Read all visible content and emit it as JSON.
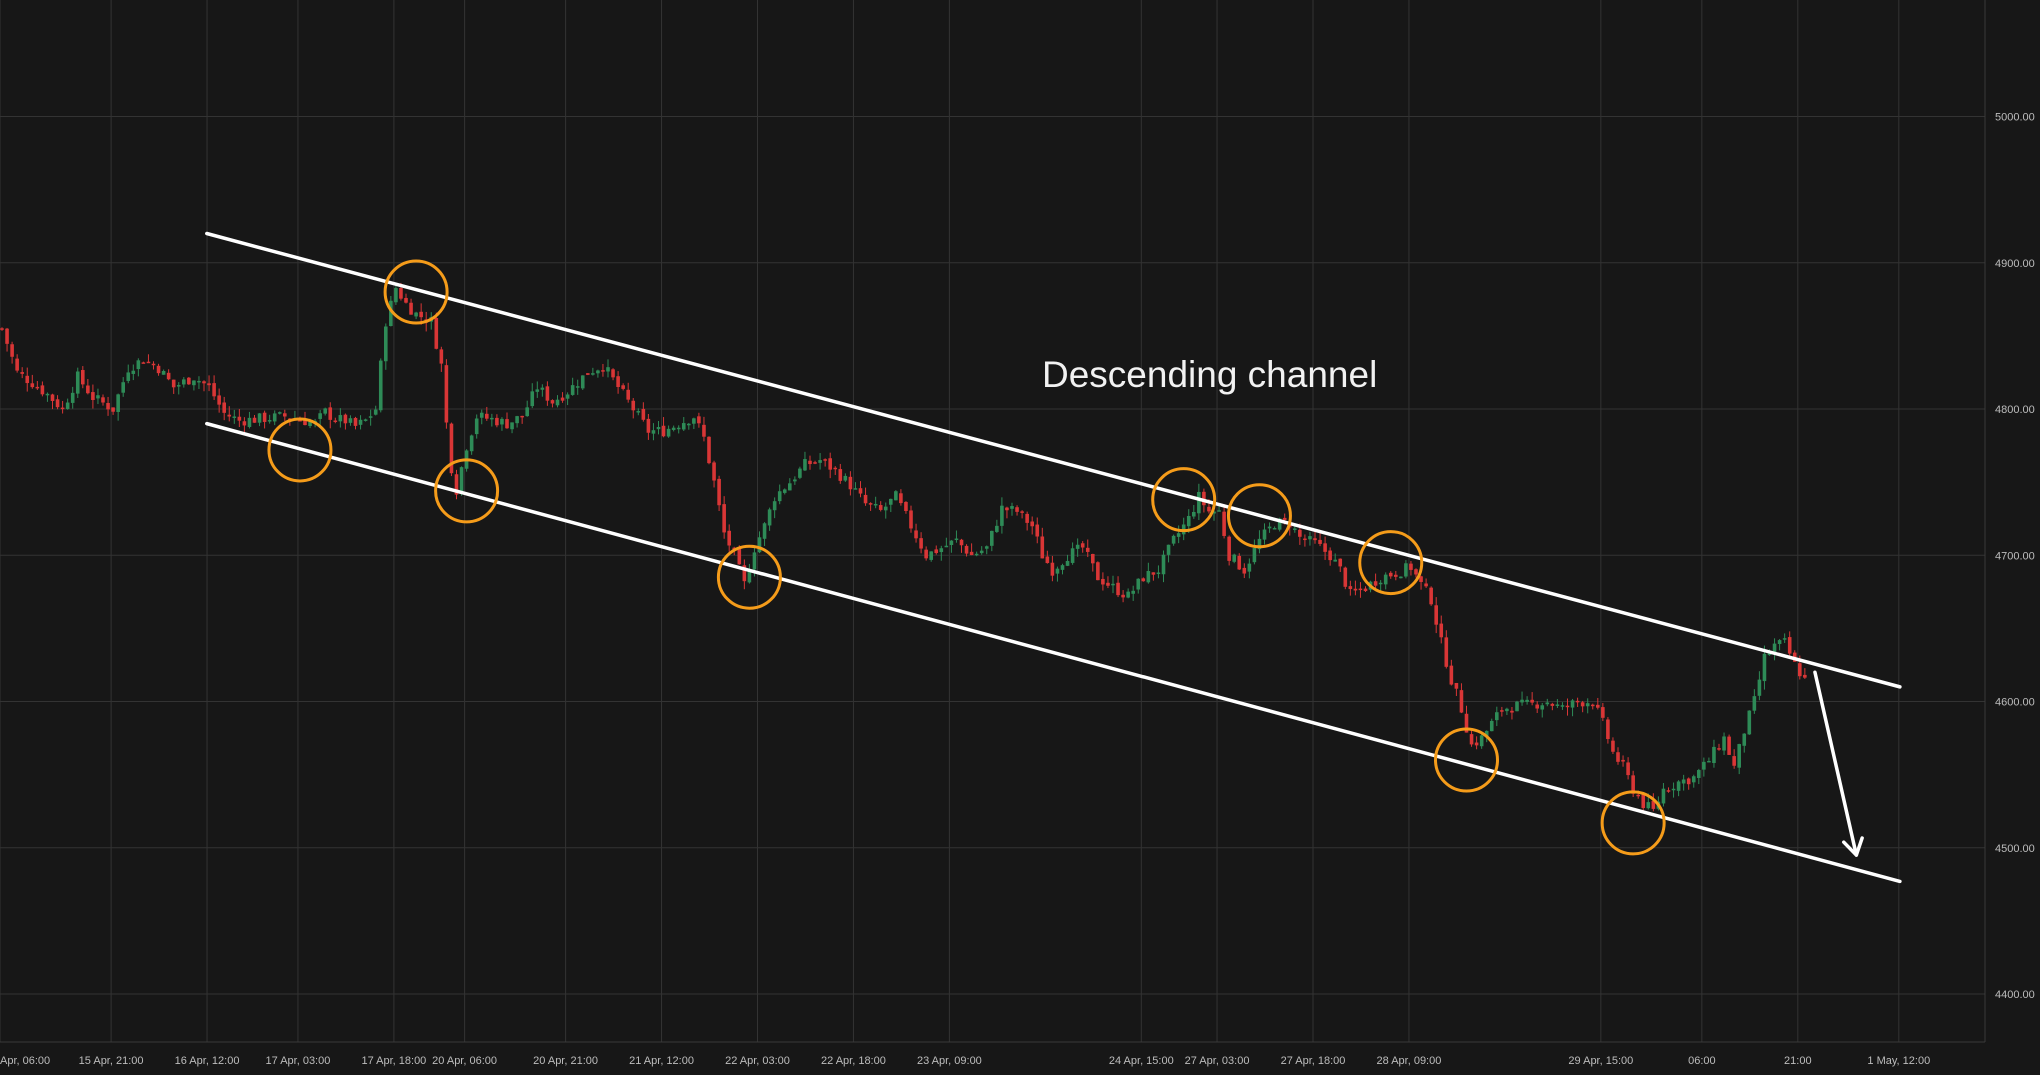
{
  "chart_data": {
    "type": "candlestick",
    "annotation": "Descending channel",
    "y_ticks": [
      4400,
      4500,
      4600,
      4700,
      4800,
      4900,
      5000
    ],
    "y_tick_labels": [
      "4400.00",
      "4500.00",
      "4600.00",
      "4700.00",
      "4800.00",
      "4900.00",
      "5000.00"
    ],
    "ylim": [
      4365,
      5035
    ],
    "x_tick_labels": [
      "Apr, 06:00",
      "15 Apr, 21:00",
      "16 Apr, 12:00",
      "17 Apr, 03:00",
      "17 Apr, 18:00",
      "20 Apr, 06:00",
      "20 Apr, 21:00",
      "21 Apr, 12:00",
      "22 Apr, 03:00",
      "22 Apr, 18:00",
      "23 Apr, 09:00",
      "24 Apr, 15:00",
      "27 Apr, 03:00",
      "27 Apr, 18:00",
      "28 Apr, 09:00",
      "29 Apr, 15:00",
      "06:00",
      "21:00",
      "1 May, 12:00"
    ],
    "x_tick_index": [
      0,
      22,
      41,
      59,
      78,
      92,
      112,
      131,
      150,
      169,
      188,
      226,
      241,
      260,
      279,
      317,
      337,
      356,
      376
    ],
    "price_path": [
      [
        0,
        4855
      ],
      [
        3,
        4825
      ],
      [
        6,
        4818
      ],
      [
        9,
        4810
      ],
      [
        12,
        4800
      ],
      [
        15,
        4822
      ],
      [
        18,
        4808
      ],
      [
        22,
        4800
      ],
      [
        25,
        4828
      ],
      [
        28,
        4834
      ],
      [
        31,
        4828
      ],
      [
        34,
        4815
      ],
      [
        38,
        4822
      ],
      [
        41,
        4815
      ],
      [
        44,
        4797
      ],
      [
        47,
        4792
      ],
      [
        50,
        4793
      ],
      [
        53,
        4794
      ],
      [
        56,
        4795
      ],
      [
        59,
        4793
      ],
      [
        62,
        4790
      ],
      [
        64,
        4798
      ],
      [
        66,
        4793
      ],
      [
        68,
        4792
      ],
      [
        70,
        4788
      ],
      [
        72,
        4792
      ],
      [
        74,
        4800
      ],
      [
        76,
        4860
      ],
      [
        78,
        4883
      ],
      [
        80,
        4872
      ],
      [
        82,
        4865
      ],
      [
        85,
        4860
      ],
      [
        87,
        4830
      ],
      [
        88,
        4790
      ],
      [
        89,
        4760
      ],
      [
        90,
        4745
      ],
      [
        92,
        4775
      ],
      [
        94,
        4795
      ],
      [
        97,
        4793
      ],
      [
        100,
        4790
      ],
      [
        103,
        4795
      ],
      [
        106,
        4815
      ],
      [
        109,
        4805
      ],
      [
        112,
        4812
      ],
      [
        116,
        4825
      ],
      [
        119,
        4830
      ],
      [
        122,
        4815
      ],
      [
        125,
        4800
      ],
      [
        128,
        4785
      ],
      [
        131,
        4785
      ],
      [
        134,
        4790
      ],
      [
        137,
        4795
      ],
      [
        139,
        4780
      ],
      [
        141,
        4750
      ],
      [
        143,
        4715
      ],
      [
        145,
        4700
      ],
      [
        147,
        4680
      ],
      [
        149,
        4705
      ],
      [
        151,
        4720
      ],
      [
        153,
        4740
      ],
      [
        156,
        4750
      ],
      [
        159,
        4762
      ],
      [
        162,
        4765
      ],
      [
        165,
        4758
      ],
      [
        168,
        4748
      ],
      [
        171,
        4735
      ],
      [
        174,
        4730
      ],
      [
        177,
        4740
      ],
      [
        180,
        4720
      ],
      [
        183,
        4700
      ],
      [
        186,
        4705
      ],
      [
        189,
        4710
      ],
      [
        192,
        4700
      ],
      [
        195,
        4705
      ],
      [
        198,
        4732
      ],
      [
        201,
        4730
      ],
      [
        204,
        4720
      ],
      [
        206,
        4700
      ],
      [
        208,
        4690
      ],
      [
        211,
        4700
      ],
      [
        214,
        4705
      ],
      [
        217,
        4685
      ],
      [
        220,
        4678
      ],
      [
        223,
        4672
      ],
      [
        226,
        4685
      ],
      [
        229,
        4690
      ],
      [
        232,
        4710
      ],
      [
        235,
        4725
      ],
      [
        237,
        4740
      ],
      [
        239,
        4730
      ],
      [
        241,
        4730
      ],
      [
        243,
        4700
      ],
      [
        246,
        4690
      ],
      [
        249,
        4710
      ],
      [
        252,
        4722
      ],
      [
        255,
        4722
      ],
      [
        257,
        4712
      ],
      [
        260,
        4708
      ],
      [
        263,
        4700
      ],
      [
        265,
        4690
      ],
      [
        267,
        4673
      ],
      [
        270,
        4678
      ],
      [
        273,
        4685
      ],
      [
        276,
        4688
      ],
      [
        279,
        4692
      ],
      [
        281,
        4680
      ],
      [
        283,
        4670
      ],
      [
        285,
        4640
      ],
      [
        287,
        4615
      ],
      [
        289,
        4595
      ],
      [
        291,
        4570
      ],
      [
        293,
        4575
      ],
      [
        295,
        4585
      ],
      [
        297,
        4595
      ],
      [
        300,
        4597
      ],
      [
        303,
        4598
      ],
      [
        306,
        4600
      ],
      [
        309,
        4595
      ],
      [
        312,
        4600
      ],
      [
        315,
        4600
      ],
      [
        317,
        4585
      ],
      [
        319,
        4565
      ],
      [
        321,
        4555
      ],
      [
        323,
        4540
      ],
      [
        325,
        4530
      ],
      [
        327,
        4525
      ],
      [
        329,
        4540
      ],
      [
        332,
        4545
      ],
      [
        335,
        4548
      ],
      [
        338,
        4560
      ],
      [
        341,
        4575
      ],
      [
        343,
        4555
      ],
      [
        345,
        4580
      ],
      [
        347,
        4600
      ],
      [
        349,
        4630
      ],
      [
        351,
        4638
      ],
      [
        353,
        4640
      ],
      [
        355,
        4625
      ],
      [
        357,
        4615
      ]
    ],
    "channel_upper": {
      "from": [
        36,
        4920
      ],
      "to": [
        398,
        4610
      ]
    },
    "channel_lower": {
      "from": [
        36,
        4790
      ],
      "to": [
        398,
        4477
      ]
    },
    "touch_points": [
      [
        82,
        4880
      ],
      [
        59,
        4772
      ],
      [
        92,
        4744
      ],
      [
        148,
        4685
      ],
      [
        234,
        4738
      ],
      [
        249,
        4727
      ],
      [
        275,
        4695
      ],
      [
        290,
        4560
      ],
      [
        323,
        4517
      ]
    ],
    "arrow": {
      "from": [
        359,
        4620
      ],
      "to": [
        367,
        4495
      ]
    },
    "colors": {
      "background": "#171717",
      "grid": "#333333",
      "up": "#2e8b57",
      "down": "#d93636",
      "channel": "#ffffff",
      "circle": "#f59c1a",
      "text": "#f2f2f2"
    }
  }
}
